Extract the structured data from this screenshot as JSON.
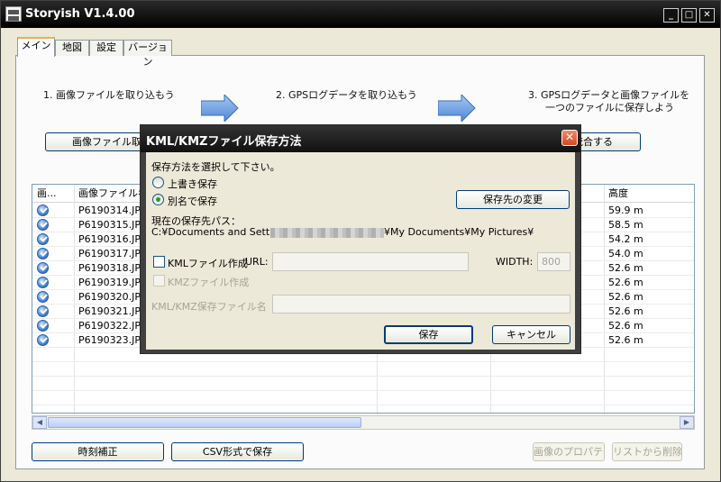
{
  "window": {
    "title": "Storyish V1.4.00",
    "minimize": "_",
    "maximize": "□",
    "close": "✕"
  },
  "tabs": [
    {
      "label": "メイン"
    },
    {
      "label": "地図"
    },
    {
      "label": "設定"
    },
    {
      "label": "バージョン"
    }
  ],
  "steps": {
    "step1": "1. 画像ファイルを取り込もう",
    "step2": "2. GPSログデータを取り込もう",
    "step3_line1": "3. GPSログデータと画像ファイルを",
    "step3_line2": "一つのファイルに保存しよう"
  },
  "buttons": {
    "import_images": "画像ファイル取り込み",
    "merge": "統合する",
    "time_correction": "時刻補正",
    "save_csv": "CSV形式で保存",
    "image_properties": "画像のプロパティ",
    "remove_from_list": "リストから削除"
  },
  "table": {
    "headers": {
      "icon": "画...",
      "filename": "画像ファイル名",
      "altitude": "高度"
    },
    "rows": [
      {
        "filename": "P6190314.JPG",
        "altitude": "59.9 m"
      },
      {
        "filename": "P6190315.JPG",
        "altitude": "58.5 m"
      },
      {
        "filename": "P6190316.JPG",
        "altitude": "54.2 m"
      },
      {
        "filename": "P6190317.JPG",
        "altitude": "54.0 m"
      },
      {
        "filename": "P6190318.JPG",
        "altitude": "52.6 m"
      },
      {
        "filename": "P6190319.JPG",
        "altitude": "52.6 m"
      },
      {
        "filename": "P6190320.JPG",
        "altitude": "52.6 m"
      },
      {
        "filename": "P6190321.JPG",
        "altitude": "52.6 m"
      },
      {
        "filename": "P6190322.JPG",
        "altitude": "52.6 m"
      },
      {
        "filename": "P6190323.JPG",
        "altitude": "52.6 m"
      }
    ],
    "scroll_left": "◀",
    "scroll_right": "▶"
  },
  "dialog": {
    "title": "KML/KMZファイル保存方法",
    "close": "✕",
    "instruction": "保存方法を選択して下さい。",
    "radio_overwrite": "上書き保存",
    "radio_save_as": "別名で保存",
    "change_dest_button": "保存先の変更",
    "current_path_label": "現在の保存先パス：",
    "path_prefix": "C:¥Documents and Settings",
    "path_suffix": "¥My Documents¥My Pictures¥",
    "kml_checkbox": "KMLファイル作成",
    "url_label": "URL:",
    "url_value": "",
    "width_label": "WIDTH:",
    "width_value": "800",
    "kmz_checkbox": "KMZファイル作成",
    "filename_label": "KML/KMZ保存ファイル名",
    "filename_value": "",
    "save_button": "保存",
    "cancel_button": "キャンセル"
  }
}
